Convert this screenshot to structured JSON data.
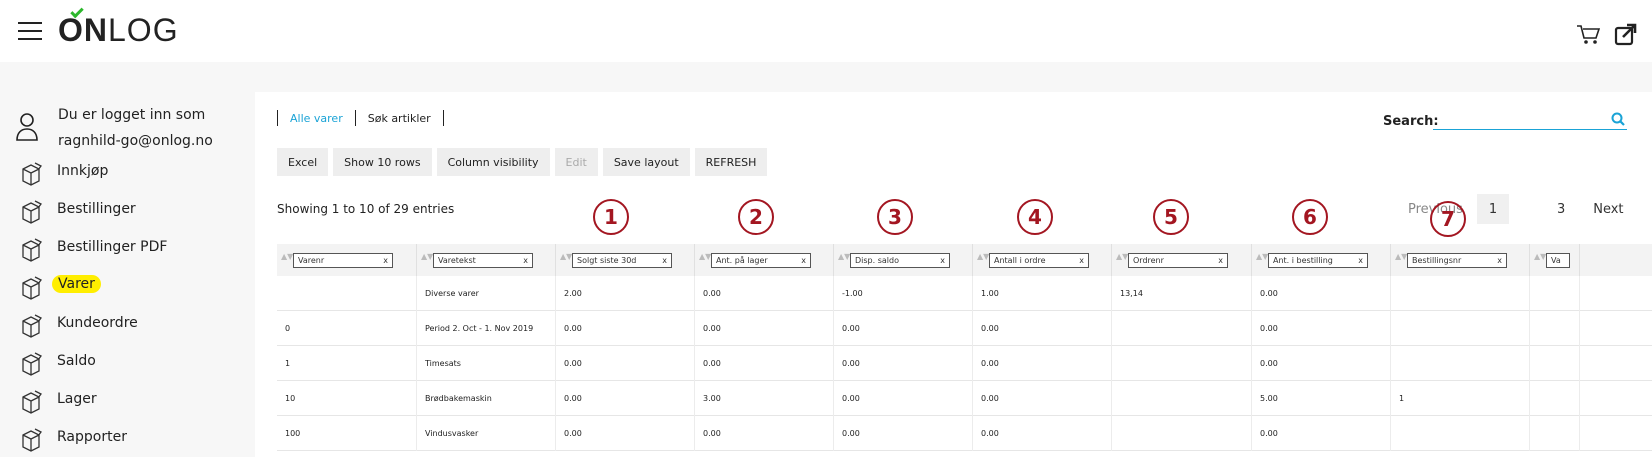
{
  "header": {
    "logo_text": "ONLOG",
    "menu_icon": "hamburger-icon",
    "cart_icon": "cart-icon",
    "external_icon": "external-link-icon",
    "accent_color": "#2db82d"
  },
  "sidebar": {
    "user_line1": "Du er logget inn som",
    "user_line2": "ragnhild-go@onlog.no",
    "items": [
      {
        "label": "Innkjøp",
        "active": false
      },
      {
        "label": "Bestillinger",
        "active": false
      },
      {
        "label": "Bestillinger PDF",
        "active": false
      },
      {
        "label": "Varer",
        "active": true
      },
      {
        "label": "Kundeordre",
        "active": false
      },
      {
        "label": "Saldo",
        "active": false
      },
      {
        "label": "Lager",
        "active": false
      },
      {
        "label": "Rapporter",
        "active": false
      }
    ],
    "highlight_color": "#ffee00"
  },
  "main": {
    "tabs": [
      {
        "label": "Alle varer",
        "active": true
      },
      {
        "label": "Søk artikler",
        "active": false
      }
    ],
    "search_label": "Search:",
    "search_value": "",
    "buttons": [
      {
        "label": "Excel",
        "disabled": false
      },
      {
        "label": "Show 10 rows",
        "disabled": false
      },
      {
        "label": "Column visibility",
        "disabled": false
      },
      {
        "label": "Edit",
        "disabled": true
      },
      {
        "label": "Save layout",
        "disabled": false
      },
      {
        "label": "REFRESH",
        "disabled": false
      }
    ],
    "info_text": "Showing 1 to 10 of 29 entries",
    "pager": {
      "previous": "Previous",
      "current": "1",
      "page3": "3",
      "next": "Next"
    },
    "annotations": [
      "1",
      "2",
      "3",
      "4",
      "5",
      "6",
      "7"
    ],
    "annotation_color": "#a31621",
    "columns": [
      "Varenr",
      "Varetekst",
      "Solgt siste 30d",
      "Ant. på lager",
      "Disp. saldo",
      "Antall i ordre",
      "Ordrenr",
      "Ant. i bestilling",
      "Bestillingsnr",
      "Va"
    ],
    "rows": [
      [
        "",
        "Diverse varer",
        "2.00",
        "0.00",
        "-1.00",
        "1.00",
        "13,14",
        "0.00",
        "",
        ""
      ],
      [
        "0",
        "Period 2. Oct - 1. Nov 2019",
        "0.00",
        "0.00",
        "0.00",
        "0.00",
        "",
        "0.00",
        "",
        ""
      ],
      [
        "1",
        "Timesats",
        "0.00",
        "0.00",
        "0.00",
        "0.00",
        "",
        "0.00",
        "",
        ""
      ],
      [
        "10",
        "Brødbakemaskin",
        "0.00",
        "3.00",
        "0.00",
        "0.00",
        "",
        "5.00",
        "1",
        ""
      ],
      [
        "100",
        "Vindusvasker",
        "0.00",
        "0.00",
        "0.00",
        "0.00",
        "",
        "0.00",
        "",
        ""
      ]
    ]
  }
}
